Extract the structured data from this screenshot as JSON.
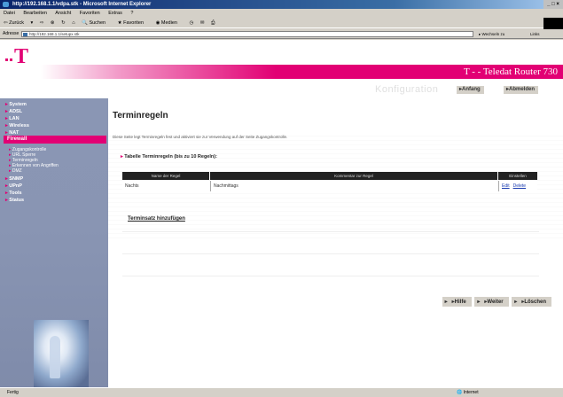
{
  "window": {
    "title": "http://192.168.1.1/vdpa.stk - Microsoft Internet Explorer"
  },
  "menubar": {
    "items": [
      "Datei",
      "Bearbeiten",
      "Ansicht",
      "Favoriten",
      "Extras",
      "?"
    ]
  },
  "toolbar": {
    "back_label": "Zurück",
    "search_label": "Suchen",
    "favorites_label": "Favoriten",
    "media_label": "Medien"
  },
  "addressbar": {
    "label": "Adresse",
    "url": "http://192.168.1.1/setupx.stk",
    "go_label": "Wechseln zu",
    "links_label": "Links"
  },
  "header": {
    "brand": "T - - Teledat Router 730",
    "section_title": "Konfiguration",
    "nav_home": "Anfang",
    "nav_logout": "Abmelden"
  },
  "sidebar": {
    "items": [
      "System",
      "ADSL",
      "LAN",
      "Wireless",
      "NAT"
    ],
    "active": "Firewall",
    "subitems": [
      "Zugangskontrolle",
      "URL Sperre",
      "Terminregeln",
      "Erkennen von Angriffen",
      "DMZ"
    ],
    "items_after": [
      "SNMP",
      "UPnP",
      "Tools",
      "Status"
    ]
  },
  "main": {
    "title": "Terminregeln",
    "intro": "Diese Seite legt Terminregeln fest und aktiviert sie zur Verwendung auf der Seite Zugangskontrolle.",
    "table_title": "Tabelle Terminregeln (bis zu 10 Regeln):",
    "columns": [
      "Name der Regel",
      "Kommentar zur Regel",
      "Einstellen"
    ],
    "rows": [
      {
        "name": "Nachts",
        "comment": "Nachmittags",
        "edit": "Edit",
        "delete": "Delete"
      }
    ],
    "add_link": "Terminsatz hinzufügen",
    "buttons": [
      "Hilfe",
      "Weiter",
      "Löschen"
    ]
  },
  "statusbar": {
    "left": "Fertig",
    "right": "Internet"
  },
  "colors": {
    "brand_magenta": "#e20074",
    "sidebar_bg": "#8a96b4",
    "ie_titlebar": "#0a246a"
  }
}
